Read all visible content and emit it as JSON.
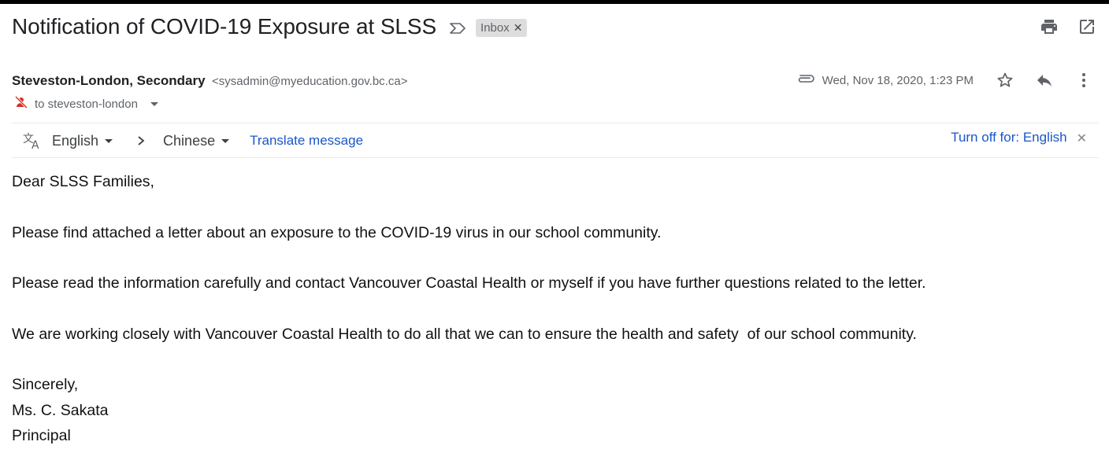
{
  "email": {
    "subject": "Notification of COVID-19 Exposure at SLSS",
    "label_chip": "Inbox",
    "sender_name": "Steveston-London, Secondary",
    "sender_email": "<sysadmin@myeducation.gov.bc.ca>",
    "to_line": "to steveston-london",
    "date": "Wed, Nov 18, 2020, 1:23 PM"
  },
  "translate": {
    "from_lang": "English",
    "to_lang": "Chinese",
    "translate_link": "Translate message",
    "turn_off": "Turn off for: English"
  },
  "body": {
    "greeting": "Dear SLSS Families,",
    "para1": "Please find attached a letter about an exposure to the COVID-19 virus in our school community.",
    "para2": "Please read the information carefully and contact Vancouver Coastal Health or myself if you have further questions related to the letter.",
    "para3": "We are working closely with Vancouver Coastal Health to do all that we can to ensure the health and safety  of our school community.",
    "closing": "Sincerely,",
    "signature_name": "Ms. C. Sakata",
    "signature_title": "Principal"
  },
  "icons": {
    "importance": "importance-marker-icon",
    "print": "print-icon",
    "open_new_window": "open-in-new-window-icon",
    "attachment": "paperclip-icon",
    "star": "star-icon",
    "reply": "reply-icon",
    "more": "more-vertical-icon",
    "no_recipient_notice": "red-crossed-person-icon",
    "translate": "translate-icon",
    "close": "close-icon"
  },
  "colors": {
    "link": "#1a56c9",
    "chip_bg": "#dddddd",
    "muted_text": "#5f6368",
    "top_bar": "#000000"
  }
}
